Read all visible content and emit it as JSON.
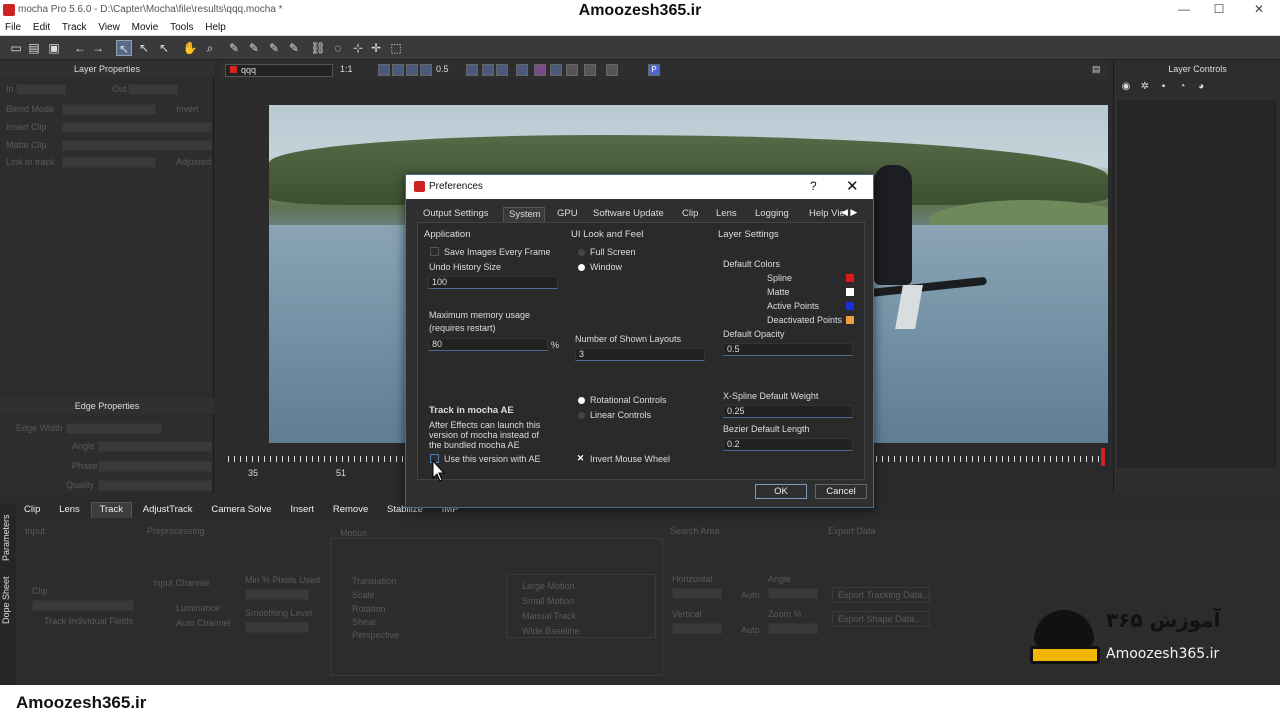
{
  "window": {
    "title": "mocha Pro 5.6.0 - D:\\Capter\\Mocha\\file\\results\\qqq.mocha *",
    "watermark": "Amoozesh365.ir"
  },
  "menu": [
    "File",
    "Edit",
    "Track",
    "View",
    "Movie",
    "Tools",
    "Help"
  ],
  "left_panel": {
    "title": "Layer Properties",
    "in_label": "In",
    "out_label": "Out",
    "blend_mode_label": "Blend Mode",
    "invert_label": "Invert",
    "insert_clip_label": "Insert Clip",
    "matte_clip_label": "Matte Clip",
    "link_to_track_label": "Link to track",
    "adjusted_label": "Adjusted",
    "edge_title": "Edge Properties",
    "edge_width_label": "Edge Width",
    "angle_label": "Angle",
    "phase_label": "Phase",
    "quality_label": "Quality"
  },
  "viewer_bar": {
    "layer_name": "qqq",
    "zoom": "1:1",
    "value": "0.5",
    "p_button": "P"
  },
  "timeline": {
    "frame_start": "35",
    "frame_mid": "51"
  },
  "right_panel": {
    "title": "Layer Controls"
  },
  "bottom_tabs": [
    "Clip",
    "Lens",
    "Track",
    "AdjustTrack",
    "Camera Solve",
    "Insert",
    "Remove",
    "Stabilize",
    "IMP"
  ],
  "bottom_active_tab": "Track",
  "side_tabs": [
    "Parameters",
    "Dope Sheet"
  ],
  "params": {
    "input": "Input",
    "preprocessing": "Preprocessing",
    "motion": "Motion",
    "search_area": "Search Area",
    "export_data": "Export Data",
    "clip": "Clip",
    "track_individual_fields": "Track Individual Fields",
    "input_channel": "Input Channel",
    "luminance": "Luminance",
    "auto_channel": "Auto Channel",
    "min_pixels_used": "Min % Pixels Used",
    "smoothing_level": "Smoothing Level",
    "motion_items": [
      "Translation",
      "Scale",
      "Rotation",
      "Shear",
      "Perspective"
    ],
    "motion_types": [
      "Large Motion",
      "Small Motion",
      "Manual Track",
      "Wide Baseline"
    ],
    "horizontal": "Horizontal",
    "vertical": "Vertical",
    "auto": "Auto",
    "angle": "Angle",
    "zoom": "Zoom %",
    "export_tracking": "Export Tracking Data...",
    "export_shape": "Export Shape Data..."
  },
  "dialog": {
    "title": "Preferences",
    "help": "?",
    "close": "✕",
    "tabs": [
      "Output Settings",
      "System",
      "GPU",
      "Software Update",
      "Clip",
      "Lens",
      "Logging",
      "Help Vie"
    ],
    "active_tab": "System",
    "application": {
      "heading": "Application",
      "save_images": "Save Images Every Frame",
      "undo_history_label": "Undo History Size",
      "undo_history_value": "100",
      "max_memory_label": "Maximum memory usage",
      "max_memory_sub": "(requires restart)",
      "max_memory_value": "80",
      "percent": "%",
      "track_ae_heading": "Track in mocha AE",
      "track_ae_desc_1": "After Effects can launch this",
      "track_ae_desc_2": "version of mocha instead of",
      "track_ae_desc_3": "the bundled mocha AE",
      "use_version": "Use this version with AE"
    },
    "ui": {
      "heading": "UI Look and Feel",
      "full_screen": "Full Screen",
      "window": "Window",
      "shown_layouts_label": "Number of Shown Layouts",
      "shown_layouts_value": "3",
      "rotational": "Rotational Controls",
      "linear": "Linear Controls",
      "invert_mouse": "Invert Mouse Wheel"
    },
    "layer": {
      "heading": "Layer Settings",
      "default_colors": "Default Colors",
      "colors": [
        {
          "name": "Spline",
          "color": "#e01818"
        },
        {
          "name": "Matte",
          "color": "#ffffff"
        },
        {
          "name": "Active Points",
          "color": "#1a2ee0"
        },
        {
          "name": "Deactivated Points",
          "color": "#f0a040"
        }
      ],
      "opacity_label": "Default Opacity",
      "opacity_value": "0.5",
      "xspline_label": "X-Spline Default Weight",
      "xspline_value": "0.25",
      "bezier_label": "Bezier Default Length",
      "bezier_value": "0.2"
    },
    "ok": "OK",
    "cancel": "Cancel"
  },
  "footer": {
    "brand": "Amoozesh365.ir"
  },
  "logo": {
    "persian": "آموزش ۳۶۵",
    "latin": "Amoozesh365.ir"
  }
}
